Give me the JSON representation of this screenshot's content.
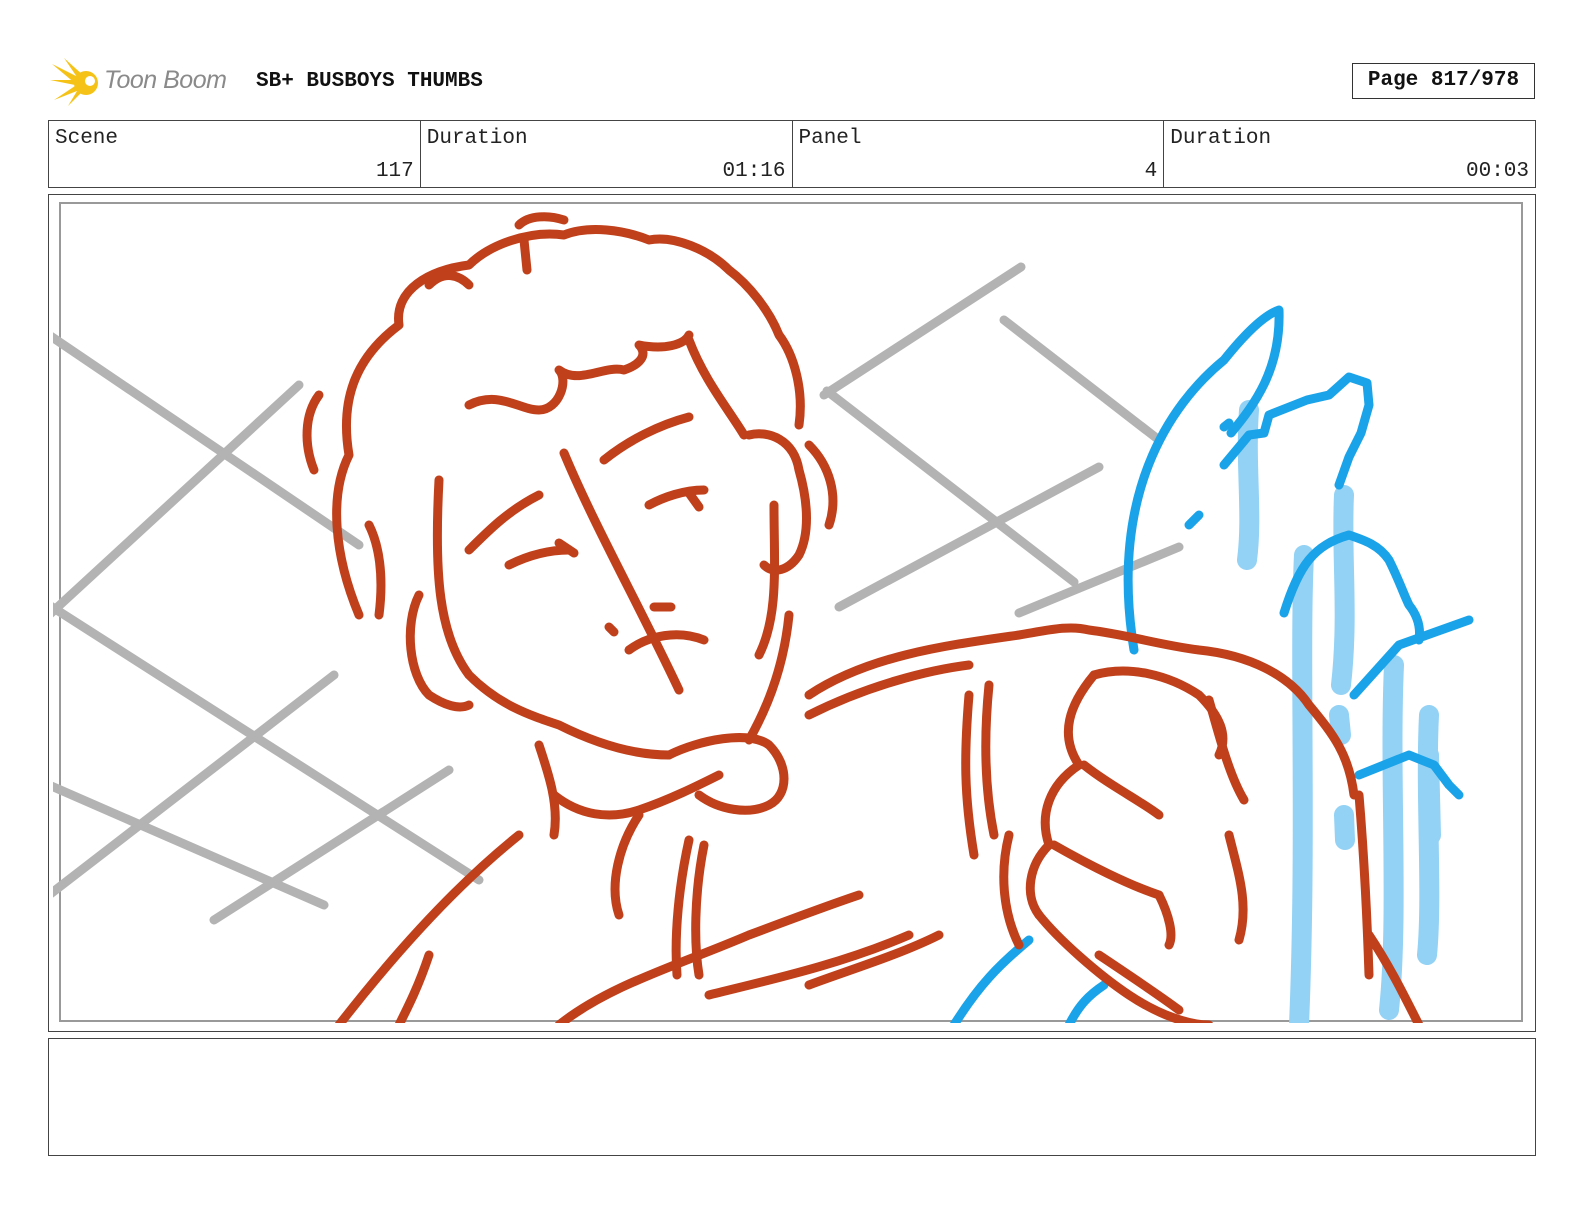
{
  "header": {
    "logo_text": "Toon Boom",
    "project_title": "SB+ BUSBOYS THUMBS",
    "page": "Page 817/978"
  },
  "info": [
    {
      "label": "Scene",
      "value": "117"
    },
    {
      "label": "Duration",
      "value": "01:16"
    },
    {
      "label": "Panel",
      "value": "4"
    },
    {
      "label": "Duration",
      "value": "00:03"
    }
  ],
  "notes": {
    "text": ""
  },
  "colors": {
    "character_lines": "#c0401b",
    "fx_lines": "#1aa3e8",
    "fx_fill": "#93d2f5",
    "background_lines": "#b3b3b3",
    "logo_yellow": "#f5c318"
  }
}
